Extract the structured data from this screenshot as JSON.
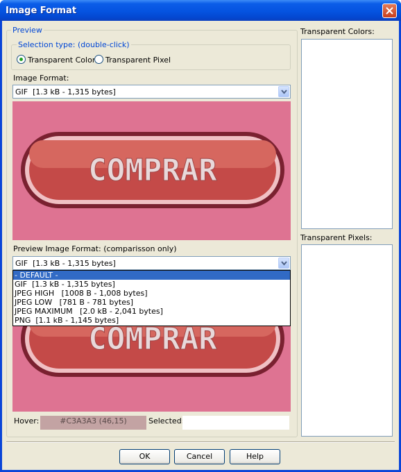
{
  "window": {
    "title": "Image Format"
  },
  "preview_group": {
    "legend": "Preview",
    "selection_type": {
      "legend": "Selection type: (double-click)",
      "options": [
        {
          "label": "Transparent Color",
          "selected": true
        },
        {
          "label": "Transparent Pixel",
          "selected": false
        }
      ]
    },
    "image_format_label": "Image Format:",
    "image_format_value": "GIF  [1.3 kB - 1,315 bytes]",
    "preview_image_format_label": "Preview Image Format: (comparisson only)",
    "preview_image_format_value": "GIF  [1.3 kB - 1,315 bytes]",
    "dropdown_options": [
      "- DEFAULT -",
      "GIF  [1.3 kB - 1,315 bytes]",
      "JPEG HIGH   [1008 B - 1,008 bytes]",
      "JPEG LOW   [781 B - 781 bytes]",
      "JPEG MAXIMUM   [2.0 kB - 2,041 bytes]",
      "PNG  [1.1 kB - 1,145 bytes]"
    ],
    "dropdown_selected_index": 0,
    "button_image_text": "COMPRAR",
    "preview_bg_color": "#de7392"
  },
  "status": {
    "hover_label": "Hover:",
    "hover_value": "#C3A3A3 (46,15)",
    "hover_color": "#c3a3a3",
    "selected_label": "Selected:",
    "selected_value": ""
  },
  "right_panel": {
    "transparent_colors_label": "Transparent Colors:",
    "transparent_pixels_label": "Transparent Pixels:"
  },
  "buttons": {
    "ok": "OK",
    "cancel": "Cancel",
    "help": "Help"
  }
}
